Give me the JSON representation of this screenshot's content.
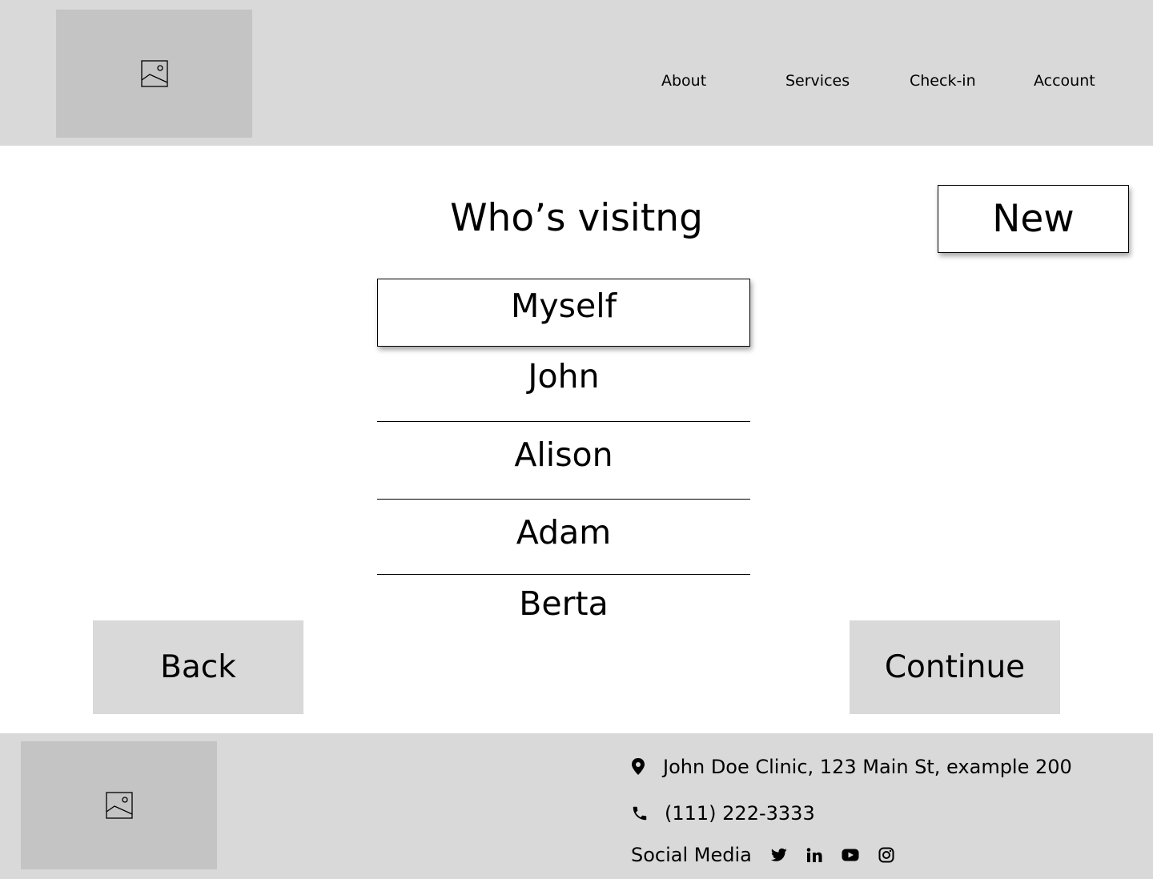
{
  "header": {
    "logo_icon": "image-placeholder-icon",
    "nav": [
      {
        "label": "About"
      },
      {
        "label": "Services"
      },
      {
        "label": "Check-in"
      },
      {
        "label": "Account"
      }
    ]
  },
  "main": {
    "title": "Who’s visitng",
    "new_label": "New",
    "visitors": [
      {
        "label": "Myself",
        "selected": true
      },
      {
        "label": "John",
        "selected": false
      },
      {
        "label": "Alison",
        "selected": false
      },
      {
        "label": "Adam",
        "selected": false
      },
      {
        "label": "Berta",
        "selected": false
      }
    ],
    "back_label": "Back",
    "continue_label": "Continue"
  },
  "footer": {
    "logo_icon": "image-placeholder-icon",
    "address": "John Doe Clinic, 123 Main St, example 200",
    "address_icon": "location-pin-icon",
    "phone": "(111) 222-3333",
    "phone_icon": "phone-icon",
    "social_label": "Social Media",
    "social_icons": [
      "twitter-icon",
      "linkedin-icon",
      "youtube-icon",
      "instagram-icon"
    ]
  },
  "colors": {
    "header_bg": "#d9d9d9",
    "placeholder_bg": "#c4c4c4",
    "button_bg": "#d9d9d9",
    "text": "#000000"
  }
}
